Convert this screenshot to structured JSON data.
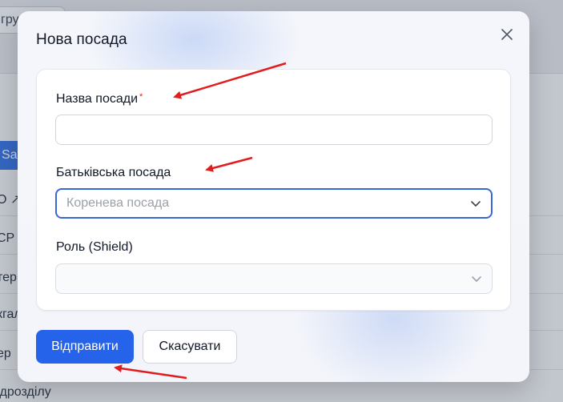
{
  "background": {
    "top_button_label": "груп",
    "save_button_label": "Sav",
    "rows": [
      "О ↗",
      "CP",
      "тер",
      "кгал",
      "ер",
      "ідрозділу"
    ]
  },
  "modal": {
    "title": "Нова посада",
    "close_icon": "close-icon",
    "fields": {
      "position_name": {
        "label": "Назва посади",
        "required_mark": "*",
        "value": ""
      },
      "parent_position": {
        "label": "Батьківська посада",
        "placeholder": "Коренева посада"
      },
      "role": {
        "label": "Роль (Shield)",
        "value": ""
      }
    },
    "buttons": {
      "submit": "Відправити",
      "cancel": "Скасувати"
    }
  },
  "colors": {
    "primary": "#2563eb",
    "focus_border": "#3b66d6",
    "required": "#dc2626",
    "annotation_arrow": "#e11d1d"
  }
}
